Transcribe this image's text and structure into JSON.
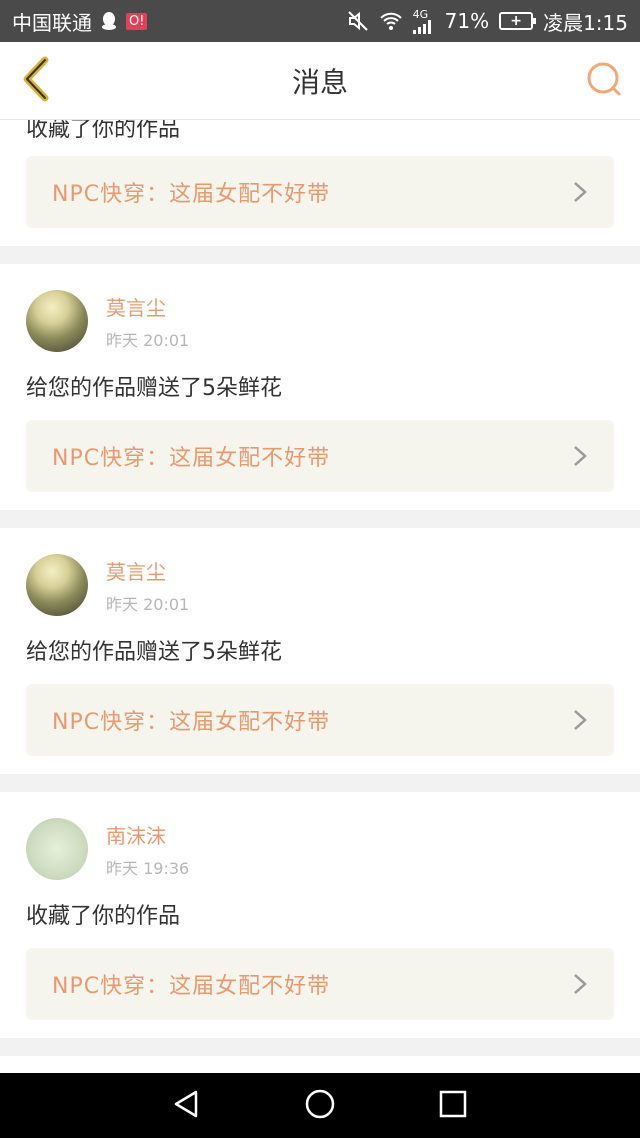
{
  "status_bar": {
    "carrier": "中国联通",
    "app_badge": "O!",
    "network": "4G",
    "battery_percent": "71%",
    "time": "凌晨1:15"
  },
  "header": {
    "title": "消息"
  },
  "messages": [
    {
      "text": "收藏了你的作品",
      "work_title": "NPC快穿：这届女配不好带"
    },
    {
      "user": "莫言尘",
      "time": "昨天 20:01",
      "text": "给您的作品赠送了5朵鲜花",
      "work_title": "NPC快穿：这届女配不好带"
    },
    {
      "user": "莫言尘",
      "time": "昨天 20:01",
      "text": "给您的作品赠送了5朵鲜花",
      "work_title": "NPC快穿：这届女配不好带"
    },
    {
      "user": "南沫沫",
      "time": "昨天 19:36",
      "text": "收藏了你的作品",
      "work_title": "NPC快穿：这届女配不好带"
    }
  ],
  "colors": {
    "accent": "#e89a6e",
    "header_icon": "#f0a878",
    "back_icon": "#d9b234"
  }
}
